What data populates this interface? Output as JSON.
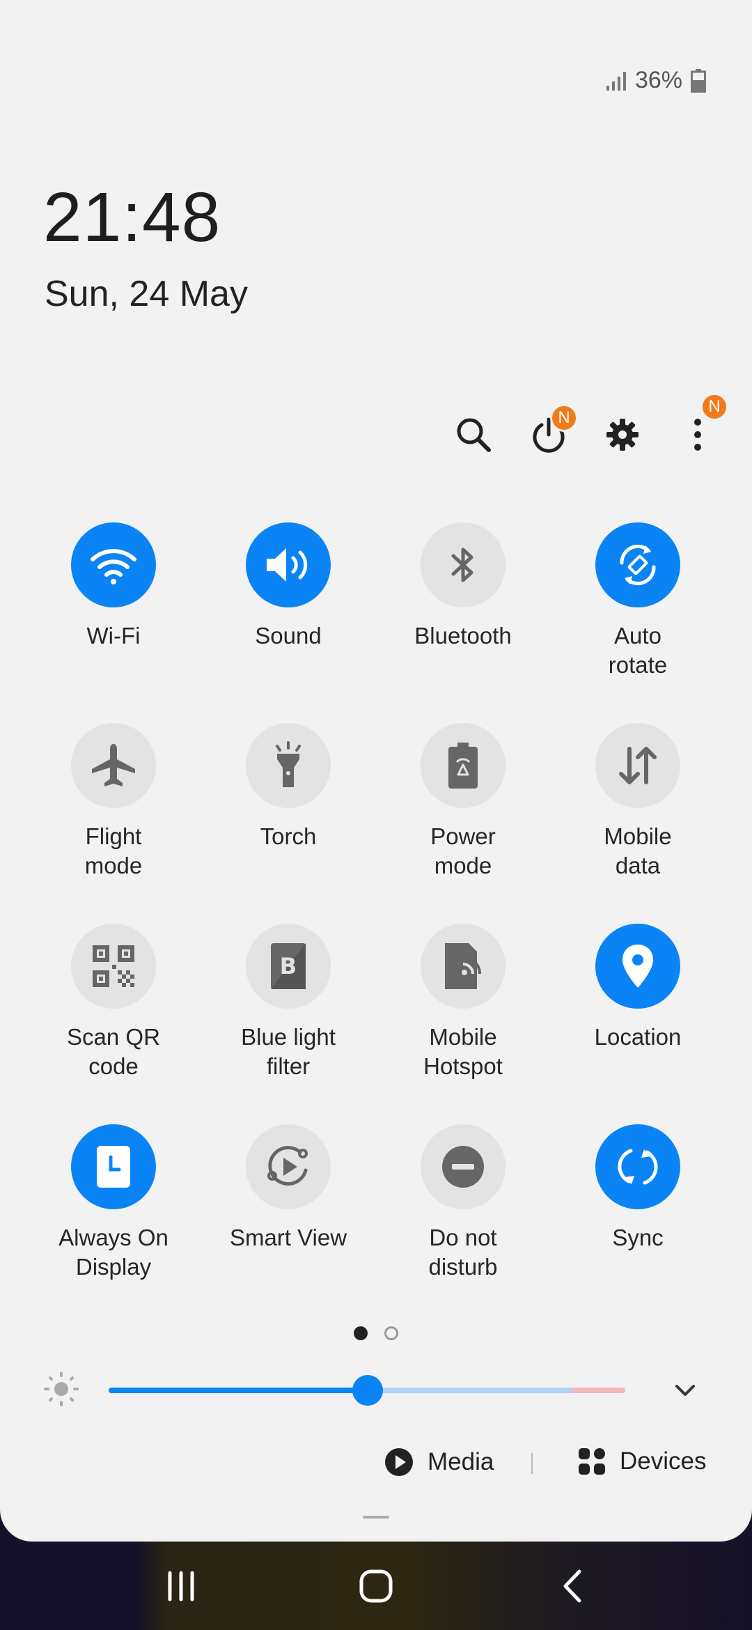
{
  "status": {
    "battery_percent": "36%",
    "signal_icon": "signal-icon",
    "battery_icon": "battery-icon"
  },
  "clock": {
    "time": "21:48",
    "date": "Sun, 24 May"
  },
  "top_actions": {
    "search_icon": "search-icon",
    "power_icon": "power-icon",
    "power_badge": "N",
    "settings_icon": "gear-icon",
    "more_icon": "more-vert-icon",
    "more_badge": "N"
  },
  "tiles": [
    {
      "label": "Wi-Fi",
      "on": true,
      "icon": "wifi-icon"
    },
    {
      "label": "Sound",
      "on": true,
      "icon": "sound-icon"
    },
    {
      "label": "Bluetooth",
      "on": false,
      "icon": "bluetooth-icon"
    },
    {
      "label": "Auto\nrotate",
      "on": true,
      "icon": "auto-rotate-icon"
    },
    {
      "label": "Flight\nmode",
      "on": false,
      "icon": "airplane-icon"
    },
    {
      "label": "Torch",
      "on": false,
      "icon": "torch-icon"
    },
    {
      "label": "Power\nmode",
      "on": false,
      "icon": "power-mode-icon"
    },
    {
      "label": "Mobile\ndata",
      "on": false,
      "icon": "mobile-data-icon"
    },
    {
      "label": "Scan QR\ncode",
      "on": false,
      "icon": "qr-code-icon"
    },
    {
      "label": "Blue light\nfilter",
      "on": false,
      "icon": "blue-light-icon"
    },
    {
      "label": "Mobile\nHotspot",
      "on": false,
      "icon": "hotspot-icon"
    },
    {
      "label": "Location",
      "on": true,
      "icon": "location-icon"
    },
    {
      "label": "Always On\nDisplay",
      "on": true,
      "icon": "always-on-display-icon"
    },
    {
      "label": "Smart View",
      "on": false,
      "icon": "smart-view-icon"
    },
    {
      "label": "Do not\ndisturb",
      "on": false,
      "icon": "do-not-disturb-icon"
    },
    {
      "label": "Sync",
      "on": true,
      "icon": "sync-icon"
    }
  ],
  "pager": {
    "pages": 2,
    "current": 1
  },
  "brightness": {
    "level_fraction": 0.5,
    "icon": "brightness-icon",
    "expand_icon": "chevron-down-icon"
  },
  "media_bar": {
    "media_label": "Media",
    "devices_label": "Devices"
  },
  "colors": {
    "accent": "#0a84f5",
    "badge": "#f27a1a",
    "tile_off": "#e3e3e3",
    "panel": "#f2f2f2"
  }
}
